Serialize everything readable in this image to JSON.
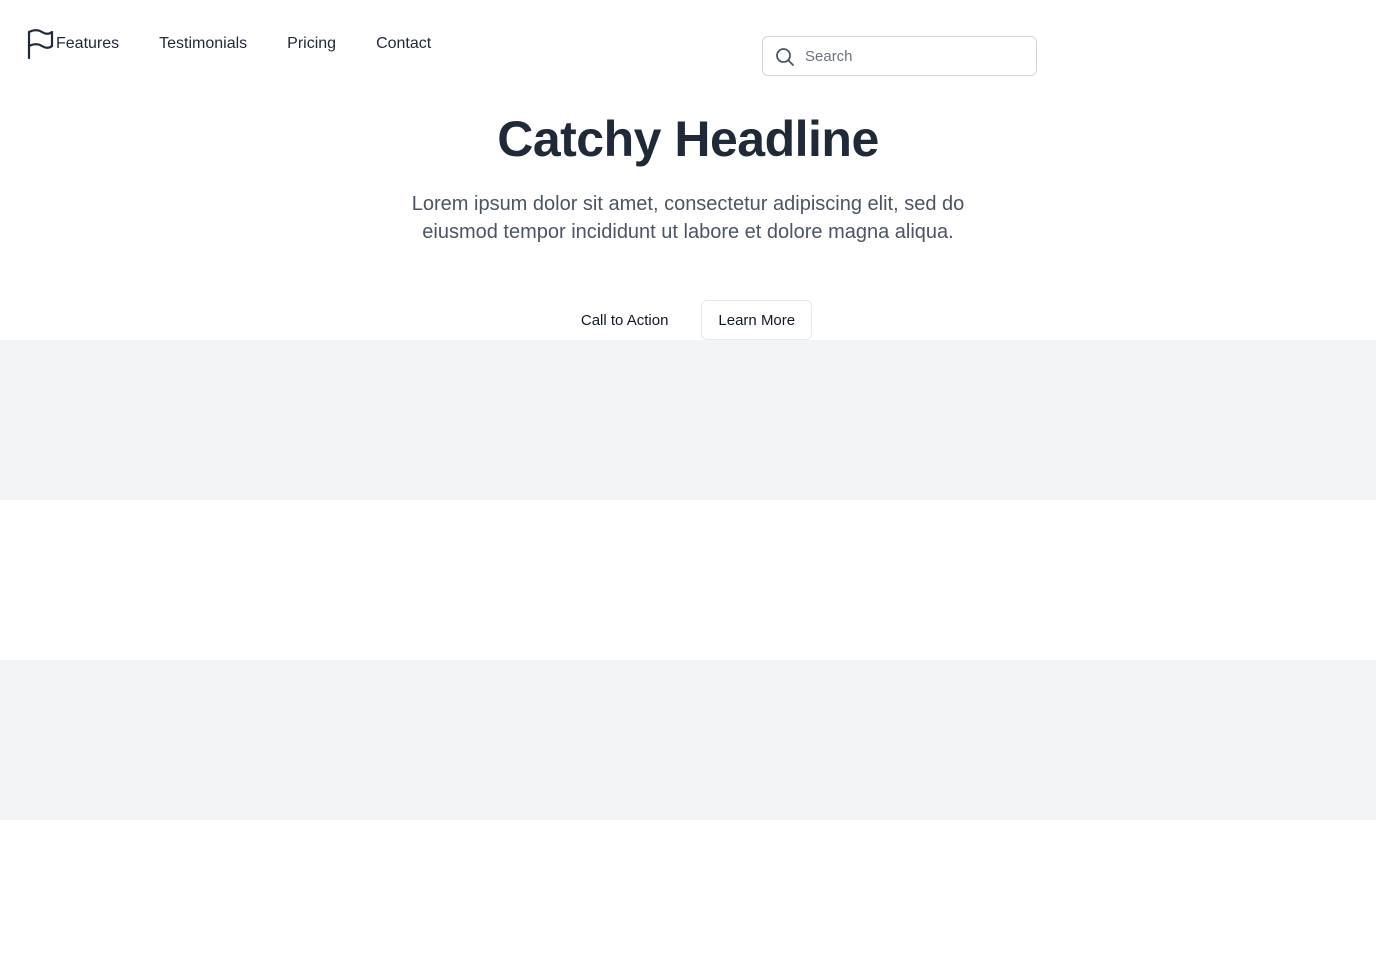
{
  "nav": {
    "logo_icon": "flag-icon",
    "links": [
      "Features",
      "Testimonials",
      "Pricing",
      "Contact"
    ]
  },
  "search": {
    "placeholder": "Search",
    "value": "",
    "icon": "search-icon"
  },
  "hero": {
    "headline": "Catchy Headline",
    "subtext": "Lorem ipsum dolor sit amet, consectetur adipiscing elit, sed do eiusmod tempor incididunt ut labore et dolore magna aliqua.",
    "primary_button": "Call to Action",
    "secondary_button": "Learn More"
  },
  "colors": {
    "text_primary": "#1f2937",
    "text_secondary": "#4b5563",
    "band_gray": "#f3f4f6",
    "border": "#d1d5db"
  }
}
